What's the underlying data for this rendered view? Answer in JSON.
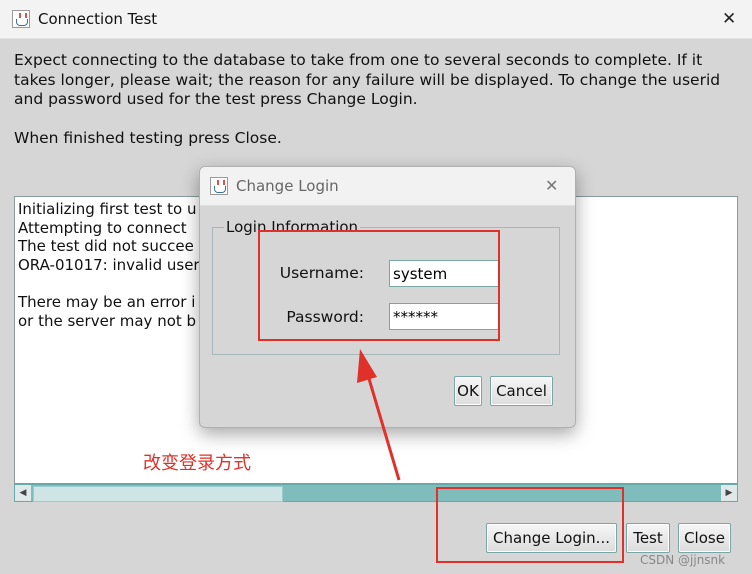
{
  "window": {
    "title": "Connection Test",
    "close_glyph": "✕",
    "icon": "java-app-icon"
  },
  "message": {
    "line1": "Expect connecting to the database to take from one to several seconds to complete. If it",
    "line2": "takes longer, please wait; the reason for any failure will be displayed. To change the userid",
    "line3": "and password used for the test press Change Login.",
    "line4": "When finished testing press Close."
  },
  "log": {
    "lines": [
      "Initializing first test to u",
      "Attempting to connect",
      "The test did not succee",
      "ORA-01017: invalid user",
      "",
      "There may be an error i",
      "or the server may not b"
    ]
  },
  "scrollbar": {
    "left_arrow": "◀",
    "right_arrow": "▶"
  },
  "buttons": {
    "change_login": "Change Login...",
    "test": "Test",
    "close": "Close"
  },
  "dialog": {
    "title": "Change Login",
    "close_glyph": "✕",
    "group_title": "Login Information",
    "username_label": "Username:",
    "username_value": "system",
    "password_label": "Password:",
    "password_value": "******",
    "ok": "OK",
    "cancel": "Cancel"
  },
  "annotation": {
    "text": "改变登录方式",
    "color": "#e0302a"
  },
  "watermark": "CSDN @jjnsnk"
}
